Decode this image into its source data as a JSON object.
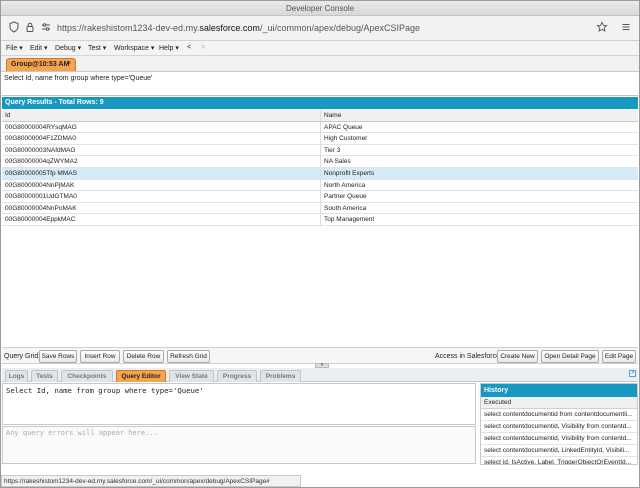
{
  "window": {
    "title": "Developer Console"
  },
  "browser": {
    "url_prefix": "https://rakeshistom1234-dev-ed.my.",
    "url_domain": "salesforce.com",
    "url_suffix": "/_ui/common/apex/debug/ApexCSIPage",
    "icons": [
      "shield-icon",
      "lock-icon",
      "site-settings-icon",
      "star-icon",
      "menu-icon"
    ]
  },
  "menu": {
    "file": "File ▾",
    "edit": "Edit ▾",
    "debug": "Debug ▾",
    "test": "Test ▾",
    "workspace": "Workspace ▾",
    "help": "Help ▾",
    "back": "<",
    "forward": ">"
  },
  "file_tab": {
    "label": "Group@10:53 AM",
    "close": "×"
  },
  "query_text": "Select Id, name from group where type='Queue'",
  "results": {
    "header": "Query Results - Total Rows: 9",
    "columns": [
      "Id",
      "Name"
    ],
    "rows": [
      {
        "id": "00G80000004RYsqMAG",
        "name": "APAC Queue"
      },
      {
        "id": "00G80000004F1ZDMA0",
        "name": "High Customer"
      },
      {
        "id": "00G80000003NAfdMAG",
        "name": "Tier 3"
      },
      {
        "id": "00G80000004qZWYMA2",
        "name": "NA Sales"
      },
      {
        "id": "00G80000005Tfp MMAS",
        "name": "Nonprofit Experts"
      },
      {
        "id": "00G80000004NnPjMAK",
        "name": "North America"
      },
      {
        "id": "00G80000001UdGTMA0",
        "name": "Partner Queue"
      },
      {
        "id": "00G80000004NnPoMAK",
        "name": "South America"
      },
      {
        "id": "00G80000004EppkMAC",
        "name": "Top Management"
      }
    ],
    "selected_row": 4
  },
  "grid_toolbar": {
    "label": "Query Grid:",
    "save_rows": "Save Rows",
    "insert_row": "Insert Row",
    "delete_row": "Delete Row",
    "refresh_grid": "Refresh Grid",
    "access_label": "Access in Salesforce:",
    "create_new": "Create New",
    "open_detail": "Open Detail Page",
    "edit_page": "Edit Page"
  },
  "panel_tabs": {
    "logs": "Logs",
    "tests": "Tests",
    "checkpoints": "Checkpoints",
    "query_editor": "Query Editor",
    "view_state": "View State",
    "progress": "Progress",
    "problems": "Problems",
    "active": "Query Editor"
  },
  "editor": {
    "query": "Select Id, name from group where type='Queue'",
    "errors_placeholder": "Any query errors will appear here..."
  },
  "history": {
    "title": "History",
    "subheader": "Executed",
    "items": [
      "select contentdocumentid from contentdocumentli...",
      "select contentdocumentid, Visibility from contentd...",
      "select contentdocumentid, Visibility from contentd...",
      "select contentdocumentid, LinkedEntityId, Visibili...",
      "select id, IsActive, Label, TriggerObjectOrEventId..."
    ]
  },
  "statusbar": {
    "text": "https://rakeshistom1234-dev-ed.my.salesforce.com/_ui/common/apex/debug/ApexCSIPage#"
  },
  "colors": {
    "accent_blue": "#1798c1",
    "active_tab_orange": "#f6a34f",
    "selected_row": "#d4ecf6"
  }
}
